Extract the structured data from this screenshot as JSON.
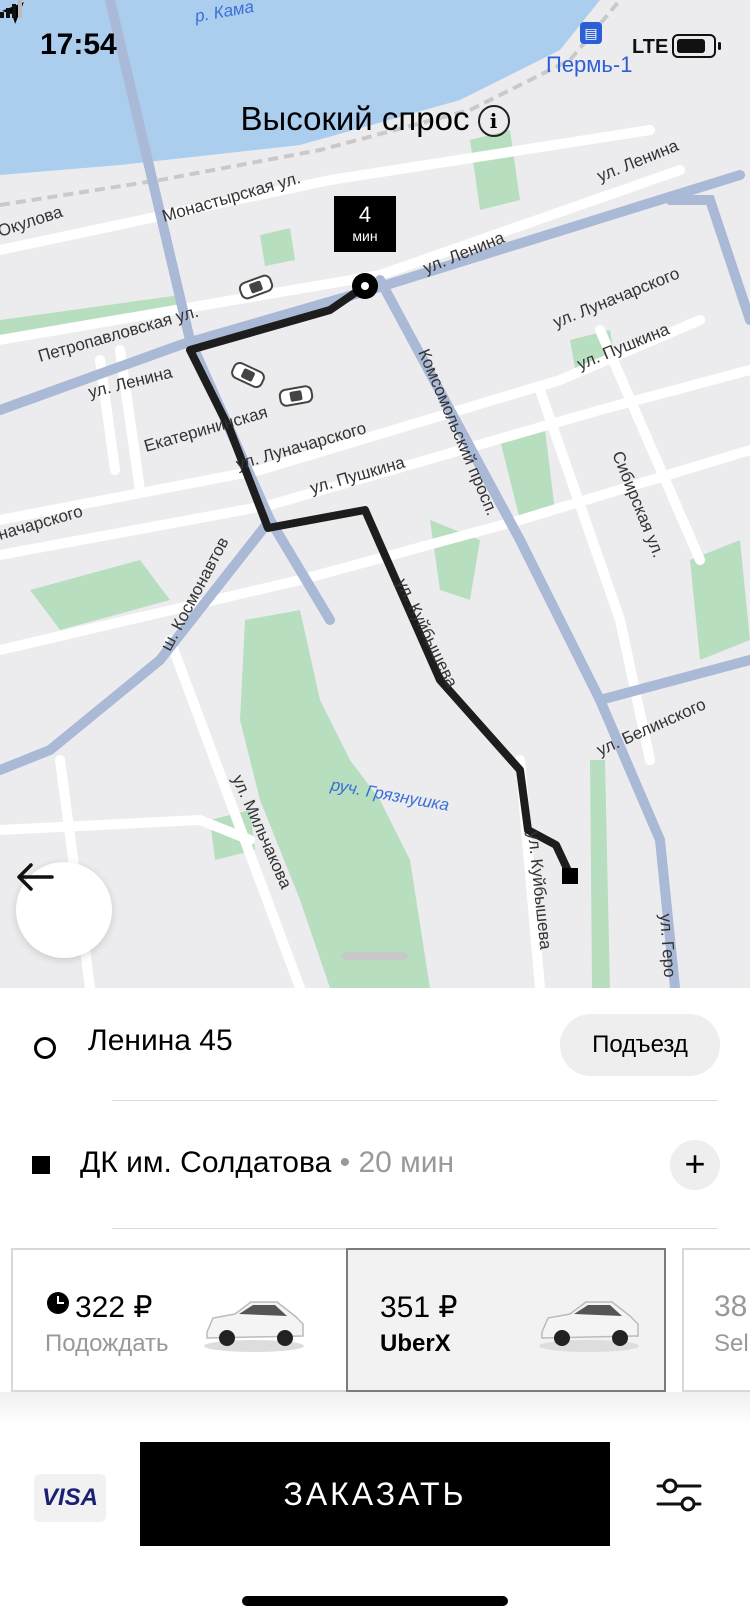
{
  "status": {
    "time": "17:54",
    "network": "LTE",
    "place": "Пермь-1"
  },
  "map": {
    "banner": "Высокий спрос",
    "eta_value": "4",
    "eta_unit": "мин",
    "labels": {
      "kama": "р. Кама",
      "okulova": "Окулова",
      "monastyrskaya": "Монастырская ул.",
      "lenina1": "ул. Ленина",
      "lenina2": "ул. Ленина",
      "lenina3": "ул. Ленина",
      "petropavlovskaya": "Петропавловская ул.",
      "lunacharskogo1": "ул. Луначарского",
      "lunacharskogo2": "ул. Луначарского",
      "lunacharskogo3": "начарского",
      "pushkina1": "ул. Пушкина",
      "pushkina2": "ул. Пушкина",
      "ekaterininskaya": "Екатерининская",
      "komsomolsky": "Комсомольский просп.",
      "sibirskaya": "Сибирская ул.",
      "kosmonavtov": "ш. Космонавтов",
      "kuibysheva1": "ул. Куйбышева",
      "kuibysheva2": "ул. Куйбышева",
      "belinskogo": "ул. Белинского",
      "milchakova": "ул. Мильчакова",
      "gryaznushka": "руч. Грязнушка",
      "geroev": "ул. Геро"
    }
  },
  "trip": {
    "pickup": "Ленина 45",
    "entrance_button": "Подъезд",
    "destination": "ДК им. Солдатова",
    "destination_eta": "• 20 мин",
    "add_stop": "+"
  },
  "options": [
    {
      "price": "322 ₽",
      "label": "Подождать"
    },
    {
      "price": "351 ₽",
      "label": "UberX"
    },
    {
      "price": "38",
      "label": "Sel"
    }
  ],
  "footer": {
    "payment": "VISA",
    "order_button": "ЗАКАЗАТЬ"
  },
  "colors": {
    "route": "#1d1d1d",
    "park": "#b7dfbf",
    "water": "#abcdee",
    "major_road": "#a9b9d6",
    "button": "#000000"
  }
}
